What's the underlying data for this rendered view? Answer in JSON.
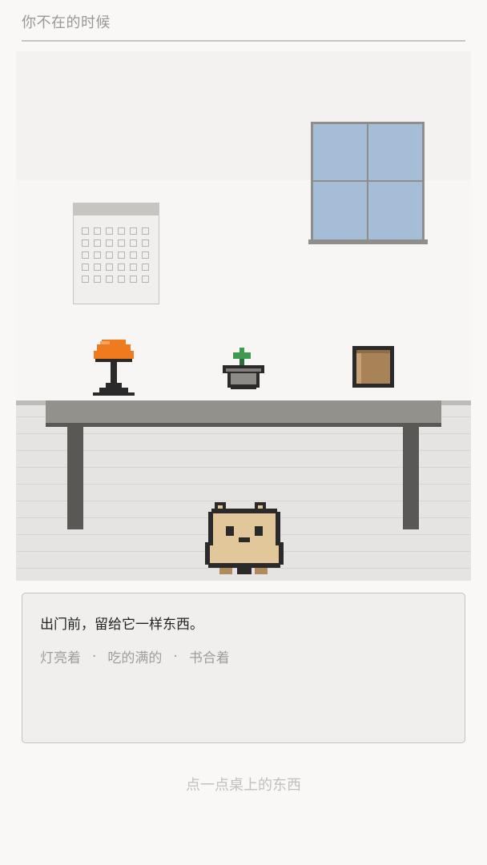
{
  "header": {
    "title": "你不在的时候"
  },
  "scene": {
    "colors": {
      "window_glass": "#a6bdd7",
      "lamp_shade": "#f07a1e",
      "plant_leaf": "#3e9a4f",
      "box_brown": "#a98358",
      "cat_body": "#e2c79b"
    },
    "items": {
      "window": "window-icon",
      "calendar": "calendar-icon",
      "lamp": "lamp-icon",
      "plant": "potted-plant-icon",
      "box": "box-icon",
      "cat": "cat-icon"
    }
  },
  "dialog": {
    "prompt": "出门前，留给它一样东西。",
    "options": [
      "灯亮着",
      "吃的满的",
      "书合着"
    ],
    "separator": "·"
  },
  "hint": "点一点桌上的东西"
}
